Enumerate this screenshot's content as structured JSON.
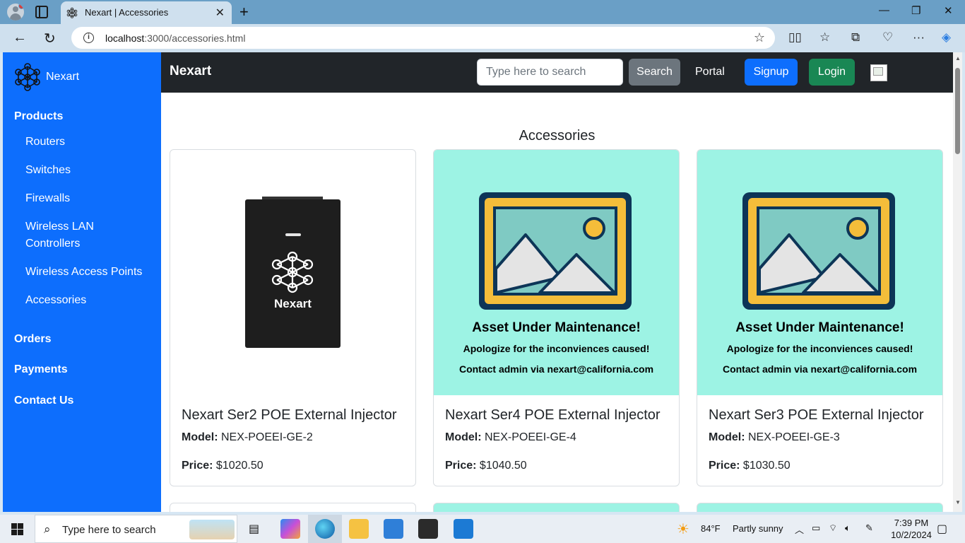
{
  "browser": {
    "tab_title": "Nexart | Accessories",
    "url_host": "localhost",
    "url_rest": ":3000/accessories.html"
  },
  "sidebar": {
    "brand": "Nexart",
    "sections": [
      {
        "label": "Products",
        "items": [
          "Routers",
          "Switches",
          "Firewalls",
          "Wireless LAN Controllers",
          "Wireless Access Points",
          "Accessories"
        ]
      },
      {
        "label": "Orders"
      },
      {
        "label": "Payments"
      },
      {
        "label": "Contact Us"
      }
    ]
  },
  "topbar": {
    "title": "Nexart",
    "search_placeholder": "Type here to search",
    "search_button": "Search",
    "portal": "Portal",
    "signup": "Signup",
    "login": "Login"
  },
  "page": {
    "heading": "Accessories"
  },
  "labels": {
    "model": "Model:",
    "price": "Price:"
  },
  "products": [
    {
      "name": "Nexart Ser2 POE External Injector",
      "model": "NEX-POEEI-GE-2",
      "price": "$1020.50",
      "image": "device"
    },
    {
      "name": "Nexart Ser4 POE External Injector",
      "model": "NEX-POEEI-GE-4",
      "price": "$1040.50",
      "image": "maintenance"
    },
    {
      "name": "Nexart Ser3 POE External Injector",
      "model": "NEX-POEEI-GE-3",
      "price": "$1030.50",
      "image": "maintenance"
    }
  ],
  "device_logo_text": "Nexart",
  "maintenance": {
    "title": "Asset Under Maintenance!",
    "line1": "Apologize for the inconviences caused!",
    "line2": "Contact admin via nexart@california.com"
  },
  "taskbar": {
    "search_placeholder": "Type here to search",
    "weather_temp": "84°F",
    "weather_desc": "Partly sunny",
    "time": "7:39 PM",
    "date": "10/2/2024"
  },
  "colors": {
    "sidebar": "#0d6efd",
    "topbar": "#212529",
    "maintenance_bg": "#9df3e4",
    "signup": "#0d6efd",
    "login": "#198754"
  }
}
